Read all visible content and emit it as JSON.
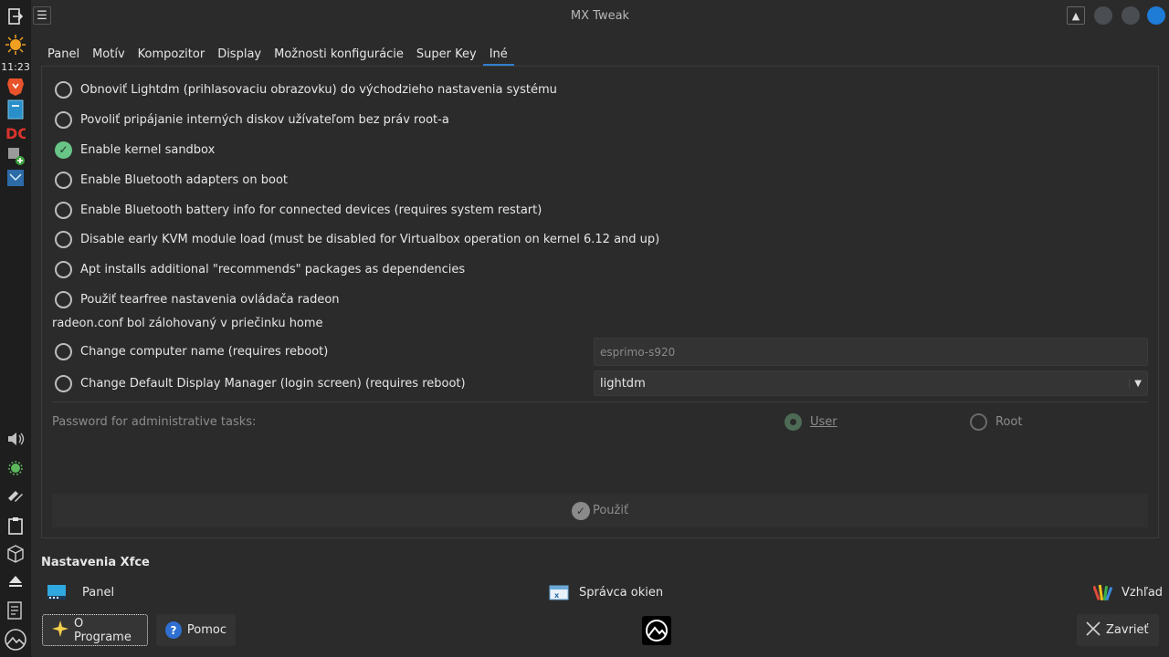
{
  "window": {
    "title": "MX Tweak"
  },
  "dock": {
    "clock": "11:23",
    "icons": [
      "logout-icon",
      "weather-sun-icon",
      "brave-browser-icon",
      "file-manager-icon",
      "doublecmd-icon",
      "usb-install-icon",
      "screenshot-icon",
      "volume-icon",
      "updater-icon",
      "network-icon",
      "clipboard-icon",
      "package-icon",
      "eject-icon",
      "notes-icon",
      "mx-menu-icon"
    ]
  },
  "tabs": [
    {
      "label": "Panel",
      "active": false
    },
    {
      "label": "Motív",
      "active": false
    },
    {
      "label": "Kompozitor",
      "active": false
    },
    {
      "label": "Display",
      "active": false
    },
    {
      "label": "Možnosti konfigurácie",
      "active": false
    },
    {
      "label": "Super Key",
      "active": false
    },
    {
      "label": "Iné",
      "active": true
    }
  ],
  "options": [
    {
      "label": "Obnoviť Lightdm (prihlasovaciu obrazovku) do východzieho nastavenia systému",
      "checked": false
    },
    {
      "label": "Povoliť pripájanie interných diskov užívateľom bez práv root-a",
      "checked": false
    },
    {
      "label": "Enable kernel sandbox",
      "checked": true
    },
    {
      "label": "Enable Bluetooth adapters on boot",
      "checked": false
    },
    {
      "label": "Enable Bluetooth battery info for connected devices (requires system restart)",
      "checked": false
    },
    {
      "label": "Disable early KVM module load (must be disabled for Virtualbox operation on kernel 6.12 and up)",
      "checked": false
    },
    {
      "label": "Apt installs additional \"recommends\" packages as dependencies",
      "checked": false
    },
    {
      "label": "Použiť tearfree nastavenia ovládača radeon",
      "checked": false
    }
  ],
  "backup_note": "radeon.conf bol zálohovaný v priečinku home",
  "hostname": {
    "label": "Change computer name (requires reboot)",
    "placeholder": "esprimo-s920"
  },
  "display_manager": {
    "label": "Change Default Display Manager (login screen) (requires reboot)",
    "value": "lightdm"
  },
  "password": {
    "label": "Password for administrative tasks:",
    "user_label": "User",
    "root_label": "Root",
    "selected": "User"
  },
  "apply_label": "Použiť",
  "xfce": {
    "title": "Nastavenia Xfce",
    "panel_label": "Panel",
    "wm_label": "Správca okien",
    "appearance_label": "Vzhľad"
  },
  "buttons": {
    "about": "O Programe",
    "help": "Pomoc",
    "close": "Zavrieť"
  },
  "colors": {
    "accent": "#2f80d1",
    "checked_green": "#68c587",
    "background": "#2b2b2b",
    "close_button": "#1e7bd6"
  }
}
